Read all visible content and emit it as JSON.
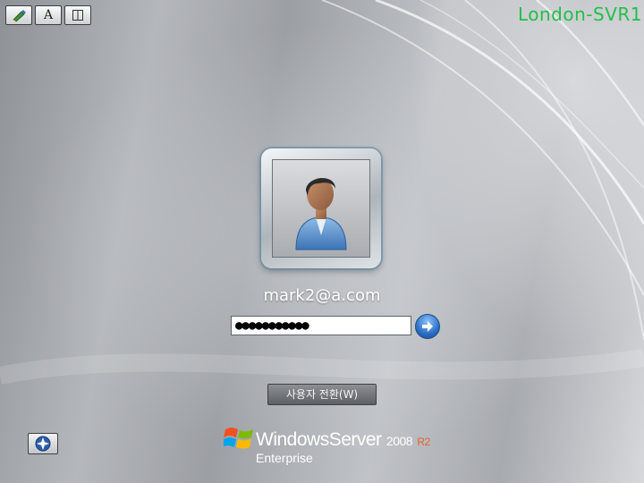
{
  "toolbar": {
    "items": [
      {
        "name": "ease-of-access-pen-icon"
      },
      {
        "name": "font-a-icon",
        "glyph": "A"
      },
      {
        "name": "split-panel-icon"
      }
    ]
  },
  "server_name": "London-SVR1",
  "user": {
    "name": "mark2@a.com",
    "password_value": "●●●●●●●●●●●",
    "avatar_icon": "user-avatar-icon"
  },
  "buttons": {
    "switch_user_label": "사용자 전환(W)",
    "submit_icon": "arrow-right-icon",
    "ease_of_access_icon": "ease-of-access-icon"
  },
  "branding": {
    "windows": "Windows",
    "server": "Server",
    "year": "2008",
    "release": "R2",
    "edition": "Enterprise"
  },
  "colors": {
    "server_name": "#22c04a",
    "accent_blue": "#2a6fc4",
    "r2_orange": "#e8632a"
  }
}
